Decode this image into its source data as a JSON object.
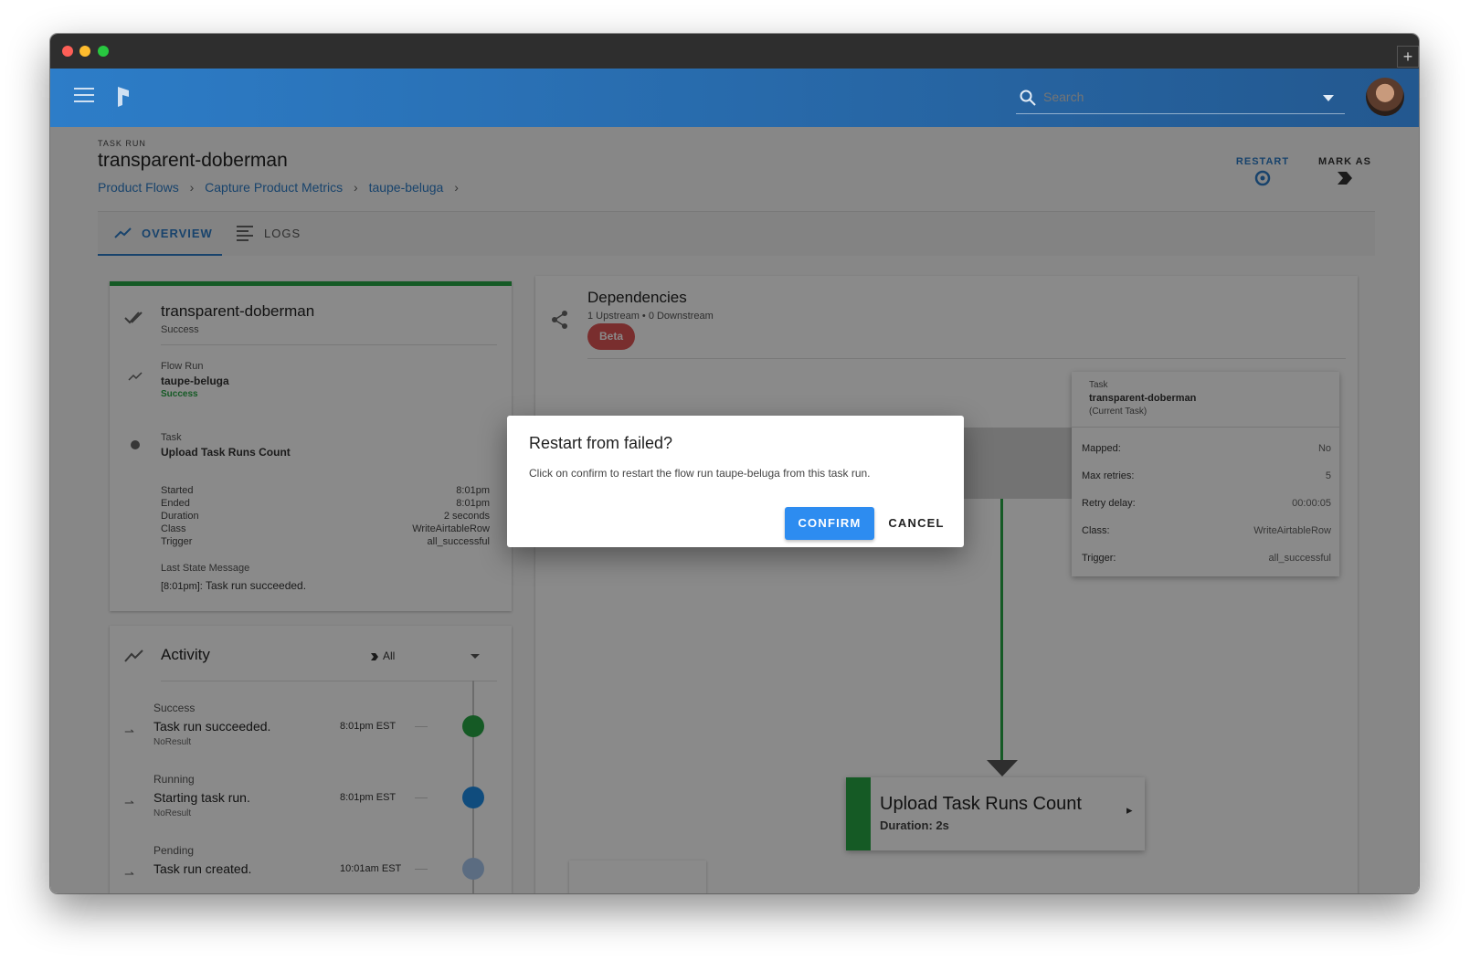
{
  "window": {
    "traffic_lights": [
      "#fe5f57",
      "#febc2e",
      "#28c840"
    ],
    "new_tab_glyph": "+"
  },
  "appbar": {
    "search_placeholder": "Search"
  },
  "header": {
    "eyebrow": "TASK RUN",
    "title": "transparent-doberman",
    "breadcrumbs": [
      "Product Flows",
      "Capture Product Metrics",
      "taupe-beluga"
    ],
    "actions": {
      "restart": "RESTART",
      "mark_as": "MARK AS"
    }
  },
  "tabs": [
    {
      "label": "OVERVIEW",
      "active": true
    },
    {
      "label": "LOGS",
      "active": false
    }
  ],
  "details_card": {
    "title": "transparent-doberman",
    "state": "Success",
    "flow_run": {
      "label": "Flow Run",
      "name": "taupe-beluga",
      "state": "Success"
    },
    "task": {
      "label": "Task",
      "name": "Upload Task Runs Count"
    },
    "fields": [
      {
        "key": "Started",
        "value": "8:01pm"
      },
      {
        "key": "Ended",
        "value": "8:01pm"
      },
      {
        "key": "Duration",
        "value": "2 seconds"
      },
      {
        "key": "Class",
        "value": "WriteAirtableRow"
      },
      {
        "key": "Trigger",
        "value": "all_successful"
      }
    ],
    "last_state_label": "Last State Message",
    "last_state_time": "[8:01pm]:",
    "last_state_message": "Task run succeeded."
  },
  "activity": {
    "title": "Activity",
    "filter": "All",
    "items": [
      {
        "state": "Success",
        "message": "Task run succeeded.",
        "result": "NoResult",
        "time": "8:01pm EST",
        "color": "#28a745"
      },
      {
        "state": "Running",
        "message": "Starting task run.",
        "result": "NoResult",
        "time": "8:01pm EST",
        "color": "#1f8de8"
      },
      {
        "state": "Pending",
        "message": "Task run created.",
        "result": "",
        "time": "10:01am EST",
        "color": "#a8c8ee"
      }
    ]
  },
  "dependencies": {
    "title": "Dependencies",
    "subtitle": "1 Upstream • 0 Downstream",
    "badge": "Beta",
    "tooltip": {
      "label": "Task",
      "name": "transparent-doberman",
      "note": "(Current Task)",
      "fields": [
        {
          "key": "Mapped:",
          "value": "No"
        },
        {
          "key": "Max retries:",
          "value": "5"
        },
        {
          "key": "Retry delay:",
          "value": "00:00:05"
        },
        {
          "key": "Class:",
          "value": "WriteAirtableRow"
        },
        {
          "key": "Trigger:",
          "value": "all_successful"
        }
      ]
    },
    "node": {
      "title": "Upload Task Runs Count",
      "duration": "Duration: 2s"
    }
  },
  "dialog": {
    "title": "Restart from failed?",
    "body": "Click on confirm to restart the flow run taupe-beluga from this task run.",
    "confirm": "CONFIRM",
    "cancel": "CANCEL"
  },
  "colors": {
    "accent": "#2d8cf0",
    "success": "#28a745",
    "beta": "#e05555",
    "appbar_start": "#2d7dc8",
    "appbar_end": "#23588f"
  }
}
